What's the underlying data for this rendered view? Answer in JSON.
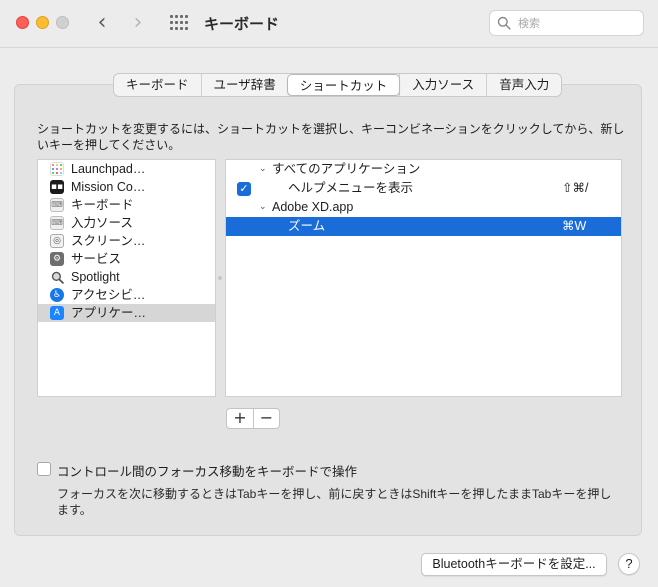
{
  "window": {
    "title": "キーボード"
  },
  "search": {
    "placeholder": "検索"
  },
  "tabs": [
    {
      "label": "キーボード",
      "active": false
    },
    {
      "label": "ユーザ辞書",
      "active": false
    },
    {
      "label": "ショートカット",
      "active": true
    },
    {
      "label": "入力ソース",
      "active": false
    },
    {
      "label": "音声入力",
      "active": false
    }
  ],
  "description": "ショートカットを変更するには、ショートカットを選択し、キーコンビネーションをクリックしてから、新しいキーを押してください。",
  "categories": [
    {
      "label": "Launchpad…",
      "icon": "launchpad-icon"
    },
    {
      "label": "Mission Co…",
      "icon": "mission-control-icon"
    },
    {
      "label": "キーボード",
      "icon": "keyboard-icon"
    },
    {
      "label": "入力ソース",
      "icon": "input-source-icon"
    },
    {
      "label": "スクリーン…",
      "icon": "screenshot-icon"
    },
    {
      "label": "サービス",
      "icon": "services-gear-icon"
    },
    {
      "label": "Spotlight",
      "icon": "spotlight-icon"
    },
    {
      "label": "アクセシビ…",
      "icon": "accessibility-icon"
    },
    {
      "label": "アプリケー…",
      "icon": "app-store-icon",
      "selected": true
    }
  ],
  "shortcuts": {
    "group_all": "すべてのアプリケーション",
    "help_menu": {
      "label": "ヘルプメニューを表示",
      "shortcut": "⇧⌘/",
      "checked": true
    },
    "group_app": "Adobe XD.app",
    "zoom": {
      "label": "ズーム",
      "shortcut": "⌘W"
    }
  },
  "buttons": {
    "add": "+",
    "remove": "−",
    "bluetooth": "Bluetoothキーボードを設定...",
    "help": "?"
  },
  "focus_option": {
    "label": "コントロール間のフォーカス移動をキーボードで操作",
    "checked": false,
    "hint": "フォーカスを次に移動するときはTabキーを押し、前に戻すときはShiftキーを押したままTabキーを押します。"
  },
  "colors": {
    "selection": "#1a6dd8",
    "close": "#fe5f57",
    "minimize": "#febc2e"
  }
}
